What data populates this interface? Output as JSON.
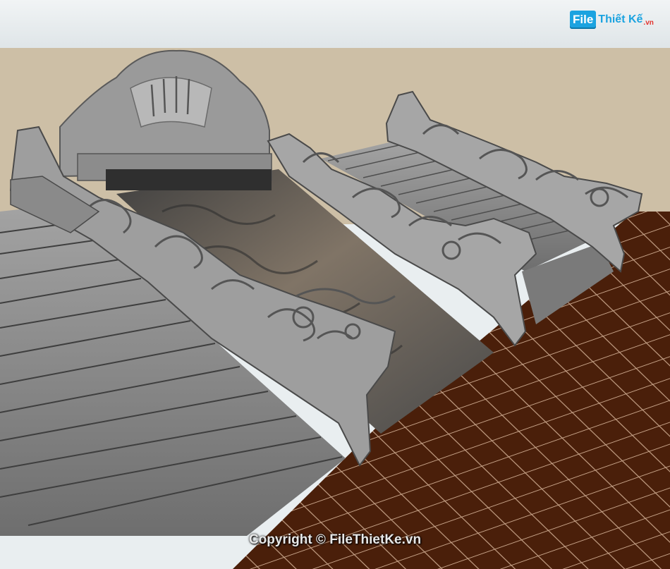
{
  "logo": {
    "file": "File",
    "name": "Thiết Kế",
    "tld": ".vn"
  },
  "copyright": "Copyright © FileThietKe.vn",
  "colors": {
    "sky": "#e9eef0",
    "wall": "#cdbfa6",
    "floor": "#4a1f0a",
    "floor_grout": "#c9a58b",
    "stone": "#8f8f8f",
    "dark_stone": "#5f5f5f",
    "brand_blue": "#1ba3e0",
    "brand_red": "#e2322c"
  }
}
